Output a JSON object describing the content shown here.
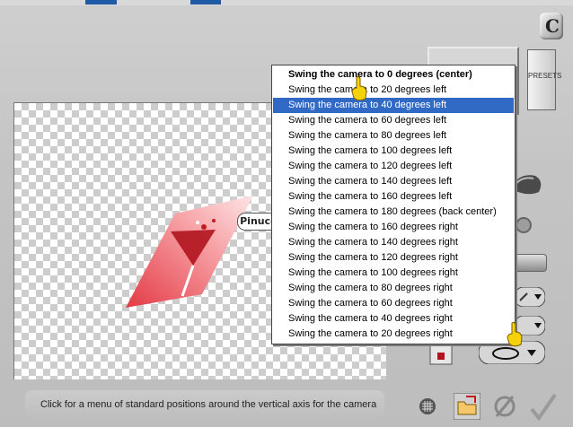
{
  "menu": {
    "items": [
      {
        "label": "Swing the camera to 0 degrees (center)",
        "bold": true,
        "selected": false
      },
      {
        "label": "Swing the camera to 20 degrees left",
        "bold": false,
        "selected": false
      },
      {
        "label": "Swing the camera to 40 degrees left",
        "bold": false,
        "selected": true
      },
      {
        "label": "Swing the camera to 60 degrees left",
        "bold": false,
        "selected": false
      },
      {
        "label": "Swing the camera to 80 degrees left",
        "bold": false,
        "selected": false
      },
      {
        "label": "Swing the camera to 100 degrees left",
        "bold": false,
        "selected": false
      },
      {
        "label": "Swing the camera to 120 degrees left",
        "bold": false,
        "selected": false
      },
      {
        "label": "Swing the camera to 140 degrees left",
        "bold": false,
        "selected": false
      },
      {
        "label": "Swing the camera to 160 degrees left",
        "bold": false,
        "selected": false
      },
      {
        "label": "Swing the camera to 180 degrees (back center)",
        "bold": false,
        "selected": false
      },
      {
        "label": "Swing the camera to 160 degrees right",
        "bold": false,
        "selected": false
      },
      {
        "label": "Swing the camera to 140 degrees right",
        "bold": false,
        "selected": false
      },
      {
        "label": "Swing the camera to 120 degrees right",
        "bold": false,
        "selected": false
      },
      {
        "label": "Swing the camera to 100 degrees right",
        "bold": false,
        "selected": false
      },
      {
        "label": "Swing the camera to 80 degrees right",
        "bold": false,
        "selected": false
      },
      {
        "label": "Swing the camera to 60 degrees right",
        "bold": false,
        "selected": false
      },
      {
        "label": "Swing the camera to 40 degrees right",
        "bold": false,
        "selected": false
      },
      {
        "label": "Swing the camera to 20 degrees right",
        "bold": false,
        "selected": false
      }
    ]
  },
  "watermark": {
    "text": "Pinuccia"
  },
  "presets": {
    "label": "PRESETS"
  },
  "status": {
    "text": "Click for a menu of standard positions around the vertical axis for the camera"
  },
  "colors": {
    "highlight": "#316ac5",
    "panel": "#c4c4c4"
  },
  "icons": [
    "logo-badge-icon",
    "pointer-hand-icon",
    "grid-icon",
    "folder-open-icon",
    "cancel-icon",
    "ok-check-icon",
    "rotate-icon",
    "dropdown-arrow-icon"
  ]
}
